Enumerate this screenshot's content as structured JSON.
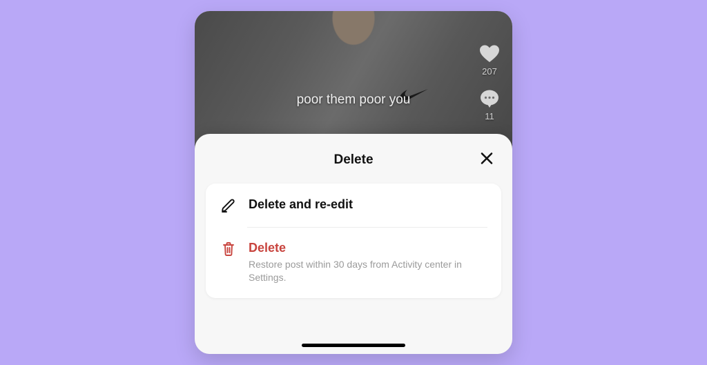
{
  "video": {
    "caption": "poor them poor you",
    "likes": "207",
    "comments": "11"
  },
  "sheet": {
    "title": "Delete",
    "row_edit": {
      "label": "Delete and re-edit"
    },
    "row_delete": {
      "label": "Delete",
      "sub": "Restore post within 30 days from Activity center in Settings."
    }
  },
  "colors": {
    "danger": "#c8443e"
  }
}
